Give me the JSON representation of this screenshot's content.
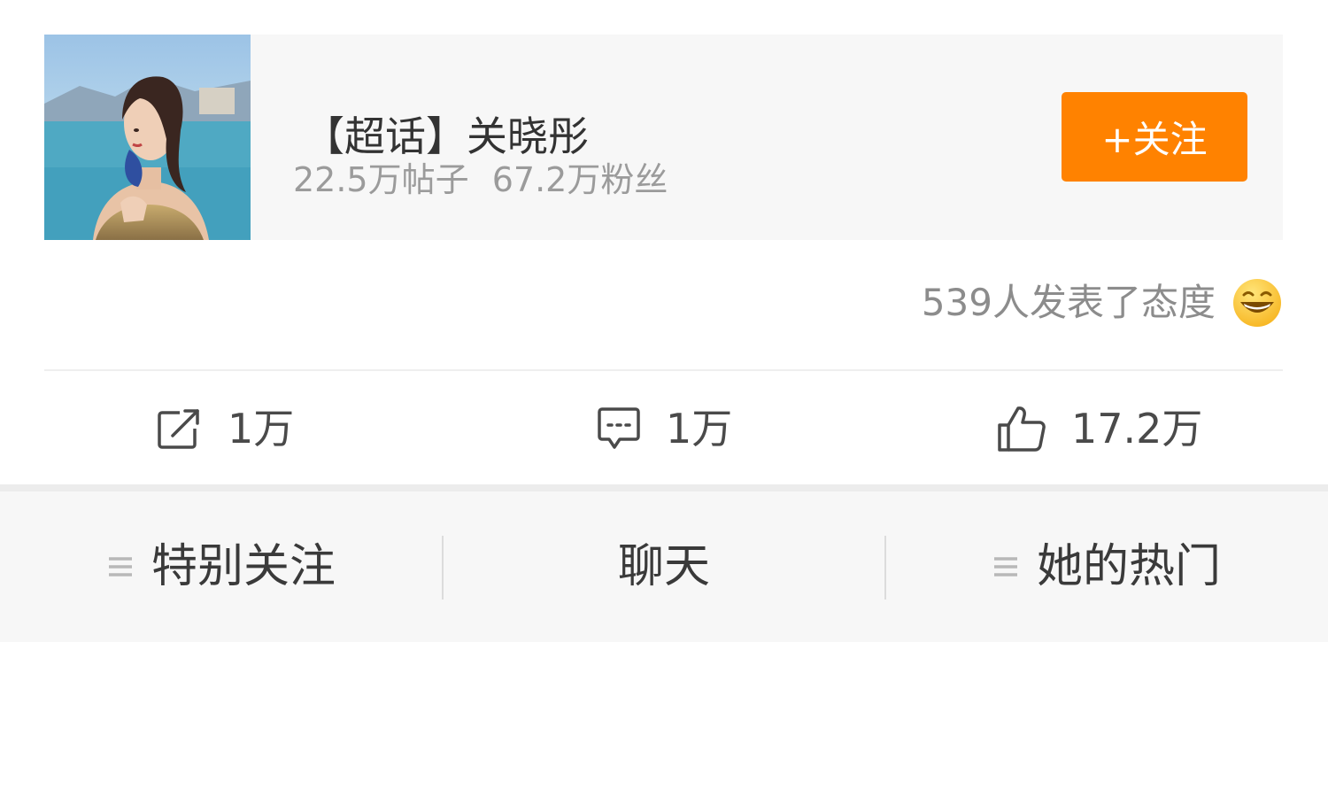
{
  "topic_card": {
    "title": "【超话】关晓彤",
    "posts": "22.5万帖子",
    "fans": "67.2万粉丝",
    "follow_label": "+关注"
  },
  "attitude": {
    "text": "539人发表了态度",
    "icon": "grinning-emoji-icon"
  },
  "actions": [
    {
      "icon": "repost-icon",
      "count": "1万"
    },
    {
      "icon": "comment-icon",
      "count": "1万"
    },
    {
      "icon": "like-icon",
      "count": "17.2万"
    }
  ],
  "bottom_bar": [
    {
      "label": "特别关注",
      "icon": "menu-icon"
    },
    {
      "label": "聊天"
    },
    {
      "label": "她的热门",
      "icon": "menu-icon"
    }
  ],
  "colors": {
    "follow_button": "#ff8200",
    "card_background": "#f7f7f7",
    "secondary_text": "#9b9b9b"
  }
}
